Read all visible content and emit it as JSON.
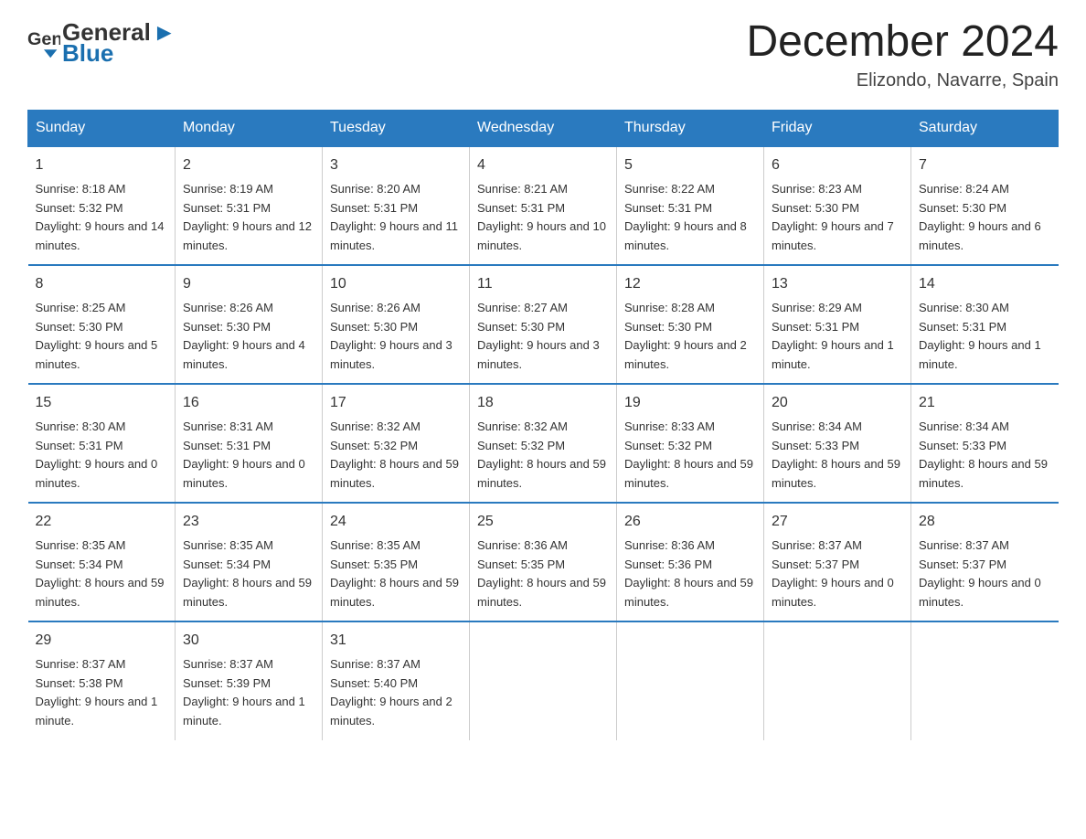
{
  "logo": {
    "text_general": "General",
    "text_blue": "Blue"
  },
  "title": "December 2024",
  "location": "Elizondo, Navarre, Spain",
  "days_of_week": [
    "Sunday",
    "Monday",
    "Tuesday",
    "Wednesday",
    "Thursday",
    "Friday",
    "Saturday"
  ],
  "weeks": [
    [
      {
        "day": "1",
        "sunrise": "8:18 AM",
        "sunset": "5:32 PM",
        "daylight": "9 hours and 14 minutes."
      },
      {
        "day": "2",
        "sunrise": "8:19 AM",
        "sunset": "5:31 PM",
        "daylight": "9 hours and 12 minutes."
      },
      {
        "day": "3",
        "sunrise": "8:20 AM",
        "sunset": "5:31 PM",
        "daylight": "9 hours and 11 minutes."
      },
      {
        "day": "4",
        "sunrise": "8:21 AM",
        "sunset": "5:31 PM",
        "daylight": "9 hours and 10 minutes."
      },
      {
        "day": "5",
        "sunrise": "8:22 AM",
        "sunset": "5:31 PM",
        "daylight": "9 hours and 8 minutes."
      },
      {
        "day": "6",
        "sunrise": "8:23 AM",
        "sunset": "5:30 PM",
        "daylight": "9 hours and 7 minutes."
      },
      {
        "day": "7",
        "sunrise": "8:24 AM",
        "sunset": "5:30 PM",
        "daylight": "9 hours and 6 minutes."
      }
    ],
    [
      {
        "day": "8",
        "sunrise": "8:25 AM",
        "sunset": "5:30 PM",
        "daylight": "9 hours and 5 minutes."
      },
      {
        "day": "9",
        "sunrise": "8:26 AM",
        "sunset": "5:30 PM",
        "daylight": "9 hours and 4 minutes."
      },
      {
        "day": "10",
        "sunrise": "8:26 AM",
        "sunset": "5:30 PM",
        "daylight": "9 hours and 3 minutes."
      },
      {
        "day": "11",
        "sunrise": "8:27 AM",
        "sunset": "5:30 PM",
        "daylight": "9 hours and 3 minutes."
      },
      {
        "day": "12",
        "sunrise": "8:28 AM",
        "sunset": "5:30 PM",
        "daylight": "9 hours and 2 minutes."
      },
      {
        "day": "13",
        "sunrise": "8:29 AM",
        "sunset": "5:31 PM",
        "daylight": "9 hours and 1 minute."
      },
      {
        "day": "14",
        "sunrise": "8:30 AM",
        "sunset": "5:31 PM",
        "daylight": "9 hours and 1 minute."
      }
    ],
    [
      {
        "day": "15",
        "sunrise": "8:30 AM",
        "sunset": "5:31 PM",
        "daylight": "9 hours and 0 minutes."
      },
      {
        "day": "16",
        "sunrise": "8:31 AM",
        "sunset": "5:31 PM",
        "daylight": "9 hours and 0 minutes."
      },
      {
        "day": "17",
        "sunrise": "8:32 AM",
        "sunset": "5:32 PM",
        "daylight": "8 hours and 59 minutes."
      },
      {
        "day": "18",
        "sunrise": "8:32 AM",
        "sunset": "5:32 PM",
        "daylight": "8 hours and 59 minutes."
      },
      {
        "day": "19",
        "sunrise": "8:33 AM",
        "sunset": "5:32 PM",
        "daylight": "8 hours and 59 minutes."
      },
      {
        "day": "20",
        "sunrise": "8:34 AM",
        "sunset": "5:33 PM",
        "daylight": "8 hours and 59 minutes."
      },
      {
        "day": "21",
        "sunrise": "8:34 AM",
        "sunset": "5:33 PM",
        "daylight": "8 hours and 59 minutes."
      }
    ],
    [
      {
        "day": "22",
        "sunrise": "8:35 AM",
        "sunset": "5:34 PM",
        "daylight": "8 hours and 59 minutes."
      },
      {
        "day": "23",
        "sunrise": "8:35 AM",
        "sunset": "5:34 PM",
        "daylight": "8 hours and 59 minutes."
      },
      {
        "day": "24",
        "sunrise": "8:35 AM",
        "sunset": "5:35 PM",
        "daylight": "8 hours and 59 minutes."
      },
      {
        "day": "25",
        "sunrise": "8:36 AM",
        "sunset": "5:35 PM",
        "daylight": "8 hours and 59 minutes."
      },
      {
        "day": "26",
        "sunrise": "8:36 AM",
        "sunset": "5:36 PM",
        "daylight": "8 hours and 59 minutes."
      },
      {
        "day": "27",
        "sunrise": "8:37 AM",
        "sunset": "5:37 PM",
        "daylight": "9 hours and 0 minutes."
      },
      {
        "day": "28",
        "sunrise": "8:37 AM",
        "sunset": "5:37 PM",
        "daylight": "9 hours and 0 minutes."
      }
    ],
    [
      {
        "day": "29",
        "sunrise": "8:37 AM",
        "sunset": "5:38 PM",
        "daylight": "9 hours and 1 minute."
      },
      {
        "day": "30",
        "sunrise": "8:37 AM",
        "sunset": "5:39 PM",
        "daylight": "9 hours and 1 minute."
      },
      {
        "day": "31",
        "sunrise": "8:37 AM",
        "sunset": "5:40 PM",
        "daylight": "9 hours and 2 minutes."
      },
      null,
      null,
      null,
      null
    ]
  ],
  "labels": {
    "sunrise": "Sunrise:",
    "sunset": "Sunset:",
    "daylight": "Daylight:"
  }
}
